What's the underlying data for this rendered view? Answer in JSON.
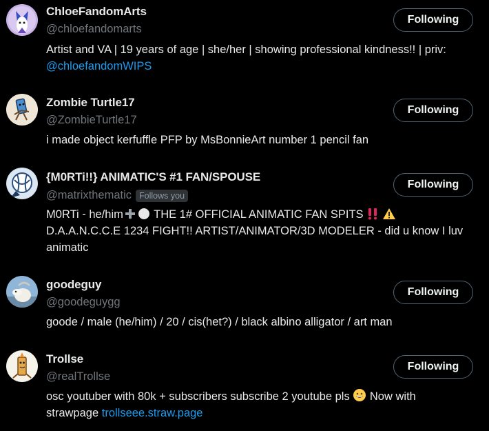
{
  "users": [
    {
      "name": "ChloeFandomArts",
      "handle": "@chloefandomarts",
      "bio_text": "Artist and VA | 19 years of age | she/her | showing professional kindness!! | priv: ",
      "bio_link": "@chloefandomWIPS",
      "button": "Following"
    },
    {
      "name": "Zombie Turtle17",
      "handle": "@ZombieTurtle17",
      "bio_text": "i made object kerfuffle PFP by MsBonnieArt number 1 pencil fan",
      "button": "Following"
    },
    {
      "name": "{M0RTi!!} ANIMATIC'S #1 FAN/SPOUSE",
      "handle": "@matrixthematic",
      "follows_you": "Follows you",
      "bio_part1": "M0RTi - he/him",
      "bio_part2": "THE 1# OFFICIAL ANIMATIC FAN SPITS",
      "bio_part3": "D.A.A.N.C.C.E 1234 FIGHT!! ARTIST/ANIMATOR/3D MODELER - did u know I luv animatic",
      "button": "Following"
    },
    {
      "name": "goodeguy",
      "handle": "@goodeguygg",
      "bio_text": "goode / male (he/him) / 20 / cis(het?) / black albino alligator / art man",
      "button": "Following"
    },
    {
      "name": "Trollse",
      "handle": "@realTrollse",
      "bio_part1": "osc youtuber with 80k + subscribers subscribe 2 youtube pls",
      "bio_part2": "Now with strawpage",
      "bio_link": "trollseee.straw.page",
      "button": "Following"
    }
  ],
  "colors": {
    "background": "#000000",
    "text": "#e7e9ea",
    "secondary": "#71767b",
    "link": "#1d9bf0",
    "button_border": "#536471"
  },
  "icons": [
    "avatar-chloe",
    "avatar-zombie-turtle",
    "avatar-morti",
    "avatar-goodeguy",
    "avatar-trollse",
    "plus-emoji",
    "white-circle-emoji",
    "double-exclamation-emoji",
    "warning-emoji",
    "grinning-emoji"
  ]
}
